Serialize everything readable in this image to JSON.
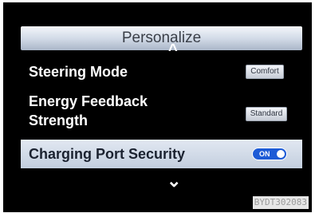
{
  "header": {
    "title": "Personalize"
  },
  "nav": {
    "up_arrow": "^",
    "down_arrow": "⌄"
  },
  "settings": [
    {
      "label": "Steering Mode",
      "value": "Comfort"
    },
    {
      "label_line1": "Energy Feedback",
      "label_line2": "Strength",
      "value": "Standard"
    },
    {
      "label": "Charging Port Security",
      "value": "ON",
      "selected": true
    }
  ],
  "watermark": "BYDT302083",
  "colors": {
    "screen_bg": "#000000",
    "header_bg": "#cfd8e5",
    "selected_row_bg": "#d2dbe8",
    "toggle_on": "#1d5bd6"
  }
}
